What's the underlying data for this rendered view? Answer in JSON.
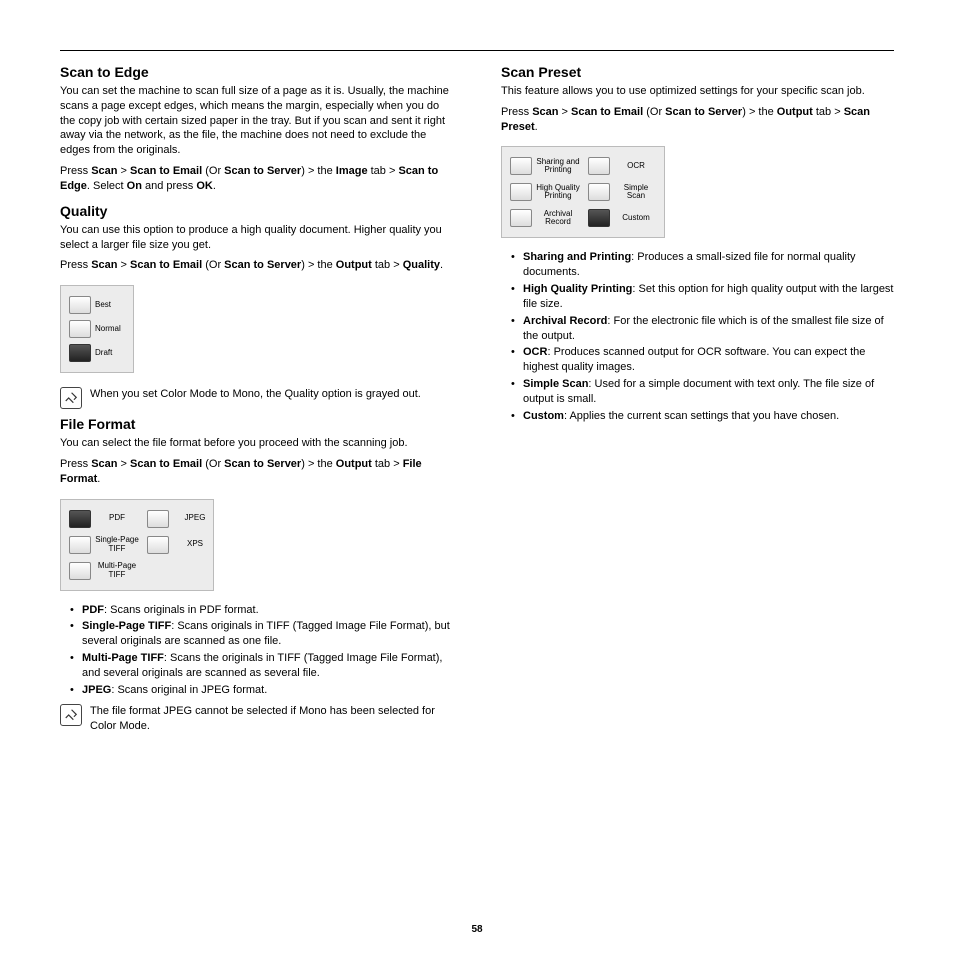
{
  "pageNumber": "58",
  "left": {
    "scanEdge": {
      "heading": "Scan to Edge",
      "body": "You can set the machine to scan full size of a page as it is. Usually, the machine scans a page except edges, which means the margin, especially when you do the copy job with certain sized paper in the tray. But if you scan and sent it right away via the network, as the file, the machine does not need to exclude the edges from the originals.",
      "nav1_parts": [
        "Press ",
        "Scan",
        " > ",
        "Scan to Email",
        " (Or ",
        "Scan to Server",
        ") > the ",
        "Image",
        " tab > ",
        "Scan to Edge",
        ". Select ",
        "On",
        " and press ",
        "OK",
        "."
      ]
    },
    "quality": {
      "heading": "Quality",
      "body": "You can use this option to produce a high quality document. Higher quality you select a larger file size you get.",
      "nav_parts": [
        "Press ",
        "Scan",
        " > ",
        "Scan to Email",
        " (Or ",
        "Scan to Server",
        ") > the ",
        "Output",
        " tab > ",
        "Quality",
        "."
      ],
      "options": [
        "Best",
        "Normal",
        "Draft"
      ],
      "selectedIndex": 2,
      "note_parts": [
        "When you set ",
        "Color Mode",
        " to ",
        "Mono",
        ", the ",
        "Quality",
        " option is grayed out."
      ]
    },
    "fileFormat": {
      "heading": "File Format",
      "body": "You can select the file format before you proceed with the scanning job.",
      "nav_parts": [
        "Press ",
        "Scan",
        " > ",
        "Scan to Email",
        " (Or ",
        "Scan to Server",
        ") > the ",
        "Output",
        " tab > ",
        "File Format",
        "."
      ],
      "options": [
        [
          "PDF",
          "JPEG"
        ],
        [
          "Single-Page TIFF",
          "XPS"
        ],
        [
          "Multi-Page TIFF",
          ""
        ]
      ],
      "selectedR": 0,
      "selectedC": 0,
      "bullets": [
        {
          "t": "PDF",
          "d": ": Scans originals in PDF format."
        },
        {
          "t": "Single-Page TIFF",
          "d": ": Scans originals in TIFF (Tagged Image File Format), but several originals are scanned as one file."
        },
        {
          "t": "Multi-Page TIFF",
          "d": ": Scans the originals in TIFF (Tagged Image File Format), and several originals are scanned as several file."
        },
        {
          "t": "JPEG",
          "d": ": Scans original in JPEG format."
        }
      ],
      "note_parts": [
        "The file format JPEG cannot be selected if ",
        "Mono",
        " has been selected for ",
        "Color Mode",
        "."
      ]
    }
  },
  "right": {
    "scanPreset": {
      "heading": "Scan Preset",
      "body": "This feature allows you to use optimized settings for your specific scan job.",
      "nav_parts": [
        "Press ",
        "Scan",
        " > ",
        "Scan to Email",
        " (Or ",
        "Scan to Server",
        ") > the ",
        "Output",
        " tab > ",
        "Scan Preset",
        "."
      ],
      "options": [
        [
          "Sharing and Printing",
          "OCR"
        ],
        [
          "High Quality Printing",
          "Simple Scan"
        ],
        [
          "Archival Record",
          "Custom"
        ]
      ],
      "selectedR": 2,
      "selectedC": 1,
      "bullets": [
        {
          "t": "Sharing and Printing",
          "d": ": Produces a small-sized file for normal quality documents."
        },
        {
          "t": "High Quality Printing",
          "d": ": Set this option for high quality output with the largest file size."
        },
        {
          "t": "Archival Record",
          "d": ": For the electronic file which is of the smallest file size of the output."
        },
        {
          "t": "OCR",
          "d": ": Produces scanned output for OCR software. You can expect the highest quality images."
        },
        {
          "t": "Simple Scan",
          "d": ": Used for a simple document with text only. The file size of output is small."
        },
        {
          "t": "Custom",
          "d": ": Applies the current scan settings that you have chosen."
        }
      ]
    }
  }
}
